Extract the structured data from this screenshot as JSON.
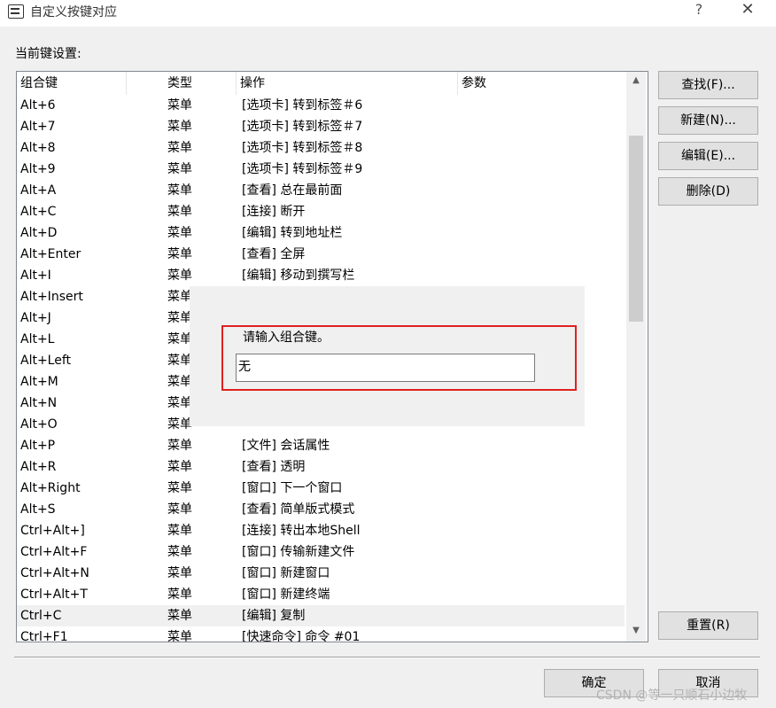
{
  "window": {
    "title": "自定义按键对应",
    "help_glyph": "?",
    "close_glyph": "✕"
  },
  "section_label": "当前键设置:",
  "columns": [
    "组合键",
    "类型",
    "操作",
    "参数"
  ],
  "rows": [
    {
      "key": "Alt+6",
      "type": "菜单",
      "action": "[选项卡] 转到标签＃6"
    },
    {
      "key": "Alt+7",
      "type": "菜单",
      "action": "[选项卡] 转到标签＃7"
    },
    {
      "key": "Alt+8",
      "type": "菜单",
      "action": "[选项卡] 转到标签＃8"
    },
    {
      "key": "Alt+9",
      "type": "菜单",
      "action": "[选项卡] 转到标签＃9"
    },
    {
      "key": "Alt+A",
      "type": "菜单",
      "action": "[查看] 总在最前面"
    },
    {
      "key": "Alt+C",
      "type": "菜单",
      "action": "[连接] 断开"
    },
    {
      "key": "Alt+D",
      "type": "菜单",
      "action": "[编辑] 转到地址栏"
    },
    {
      "key": "Alt+Enter",
      "type": "菜单",
      "action": "[查看] 全屏"
    },
    {
      "key": "Alt+I",
      "type": "菜单",
      "action": "[编辑] 移动到撰写栏"
    },
    {
      "key": "Alt+Insert",
      "type": "菜单",
      "action": ""
    },
    {
      "key": "Alt+J",
      "type": "菜单",
      "action": ""
    },
    {
      "key": "Alt+L",
      "type": "菜单",
      "action": ""
    },
    {
      "key": "Alt+Left",
      "type": "菜单",
      "action": ""
    },
    {
      "key": "Alt+M",
      "type": "菜单",
      "action": ""
    },
    {
      "key": "Alt+N",
      "type": "菜单",
      "action": ""
    },
    {
      "key": "Alt+O",
      "type": "菜单",
      "action": ""
    },
    {
      "key": "Alt+P",
      "type": "菜单",
      "action": "[文件] 会话属性"
    },
    {
      "key": "Alt+R",
      "type": "菜单",
      "action": "[查看] 透明"
    },
    {
      "key": "Alt+Right",
      "type": "菜单",
      "action": "[窗口] 下一个窗口"
    },
    {
      "key": "Alt+S",
      "type": "菜单",
      "action": "[查看] 简单版式模式"
    },
    {
      "key": "Ctrl+Alt+]",
      "type": "菜单",
      "action": "[连接] 转出本地Shell"
    },
    {
      "key": "Ctrl+Alt+F",
      "type": "菜单",
      "action": "[窗口] 传输新建文件"
    },
    {
      "key": "Ctrl+Alt+N",
      "type": "菜单",
      "action": "[窗口] 新建窗口"
    },
    {
      "key": "Ctrl+Alt+T",
      "type": "菜单",
      "action": "[窗口] 新建终端"
    },
    {
      "key": "Ctrl+C",
      "type": "菜单",
      "action": "[编辑] 复制"
    },
    {
      "key": "Ctrl+F1",
      "type": "菜单",
      "action": "[快速命令] 命令 #01"
    }
  ],
  "buttons": {
    "find": "查找(F)...",
    "new": "新建(N)...",
    "edit": "编辑(E)...",
    "delete": "删除(D)",
    "reset": "重置(R)",
    "ok": "确定",
    "cancel": "取消"
  },
  "key_prompt": {
    "label": "请输入组合键。",
    "value": "无"
  },
  "watermark": "CSDN @等一只顺石小边牧",
  "colors": {
    "highlight_border": "#e02020",
    "selected_row": "#f0f0f0"
  }
}
